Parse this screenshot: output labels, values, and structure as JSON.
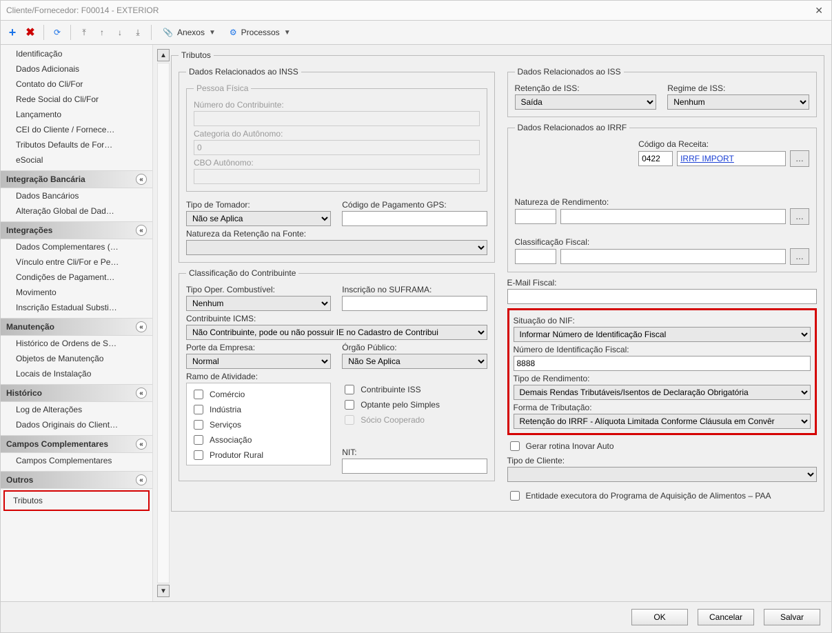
{
  "window": {
    "title": "Cliente/Fornecedor: F00014 - EXTERIOR"
  },
  "toolbar": {
    "anexos": "Anexos",
    "processos": "Processos"
  },
  "sidebar": {
    "top_items": [
      "Identificação",
      "Dados Adicionais",
      "Contato do Cli/For",
      "Rede Social do Cli/For",
      "Lançamento",
      "CEI do Cliente /  Fornece…",
      "Tributos Defaults de For…",
      "eSocial"
    ],
    "groups": [
      {
        "title": "Integração Bancária",
        "items": [
          "Dados Bancários",
          "Alteração Global de Dad…"
        ]
      },
      {
        "title": "Integrações",
        "items": [
          "Dados Complementares (…",
          "Vínculo entre Cli/For e Pe…",
          "Condições de Pagament…",
          "Movimento",
          "Inscrição Estadual Substi…"
        ]
      },
      {
        "title": "Manutenção",
        "items": [
          "Histórico de Ordens de S…",
          "Objetos de Manutenção",
          "Locais de Instalação"
        ]
      },
      {
        "title": "Histórico",
        "items": [
          "Log de Alterações",
          "Dados Originais do Client…"
        ]
      },
      {
        "title": "Campos Complementares",
        "items": [
          "Campos Complementares"
        ]
      },
      {
        "title": "Outros",
        "items": [
          "Tributos"
        ],
        "highlight_item_index": 0
      }
    ]
  },
  "tributos": {
    "legend": "Tributos",
    "inss": {
      "legend": "Dados Relacionados ao INSS",
      "pf_legend": "Pessoa Física",
      "num_contrib_label": "Número do Contribuinte:",
      "num_contrib_value": "",
      "categoria_label": "Categoria do Autônomo:",
      "categoria_value": "0",
      "cbo_label": "CBO Autônomo:",
      "cbo_value": "",
      "tipo_tomador_label": "Tipo de Tomador:",
      "tipo_tomador_value": "Não se Aplica",
      "codigo_gps_label": "Código de Pagamento GPS:",
      "codigo_gps_value": "",
      "natureza_ret_label": "Natureza da Retenção na Fonte:",
      "natureza_ret_value": ""
    },
    "iss": {
      "legend": "Dados Relacionados ao ISS",
      "retencao_label": "Retenção de ISS:",
      "retencao_value": "Saída",
      "regime_label": "Regime de ISS:",
      "regime_value": "Nenhum"
    },
    "irrf": {
      "legend": "Dados Relacionados ao IRRF",
      "codigo_receita_label": "Código da Receita:",
      "codigo_receita_code": "0422",
      "codigo_receita_desc": "IRRF IMPORT",
      "natureza_rend_label": "Natureza de Rendimento:",
      "classificacao_fiscal_label": "Classificação Fiscal:"
    },
    "contribuinte": {
      "legend": "Classificação do Contribuinte",
      "tipo_oper_label": "Tipo Oper. Combustível:",
      "tipo_oper_value": "Nenhum",
      "suframa_label": "Inscrição no SUFRAMA:",
      "suframa_value": "",
      "icms_label": "Contribuinte ICMS:",
      "icms_value": "Não Contribuinte, pode ou não possuir IE no Cadastro de Contribui",
      "porte_label": "Porte da Empresa:",
      "porte_value": "Normal",
      "orgao_label": "Órgão Público:",
      "orgao_value": "Não Se Aplica",
      "ramo_label": "Ramo de Atividade:",
      "ramo_items": [
        "Comércio",
        "Indústria",
        "Serviços",
        "Associação",
        "Produtor Rural"
      ],
      "contrib_iss_label": "Contribuinte ISS",
      "optante_simples_label": "Optante pelo Simples",
      "socio_cooperado_label": "Sócio Cooperado",
      "nit_label": "NIT:"
    },
    "email_fiscal_label": "E-Mail Fiscal:",
    "nif_box": {
      "situacao_label": "Situação do NIF:",
      "situacao_value": "Informar Número de Identificação Fiscal",
      "numero_label": "Número de Identificação Fiscal:",
      "numero_value": "8888",
      "tipo_rendimento_label": "Tipo de Rendimento:",
      "tipo_rendimento_value": "Demais Rendas Tributáveis/Isentos de Declaração Obrigatória",
      "forma_trib_label": "Forma de Tributação:",
      "forma_trib_value": "Retenção do IRRF - Alíquota Limitada Conforme Cláusula em Convêr"
    },
    "gerar_inovar_label": "Gerar rotina Inovar Auto",
    "tipo_cliente_label": "Tipo de Cliente:",
    "paa_label": "Entidade executora do Programa de Aquisição de Alimentos – PAA"
  },
  "footer": {
    "ok": "OK",
    "cancelar": "Cancelar",
    "salvar": "Salvar"
  }
}
